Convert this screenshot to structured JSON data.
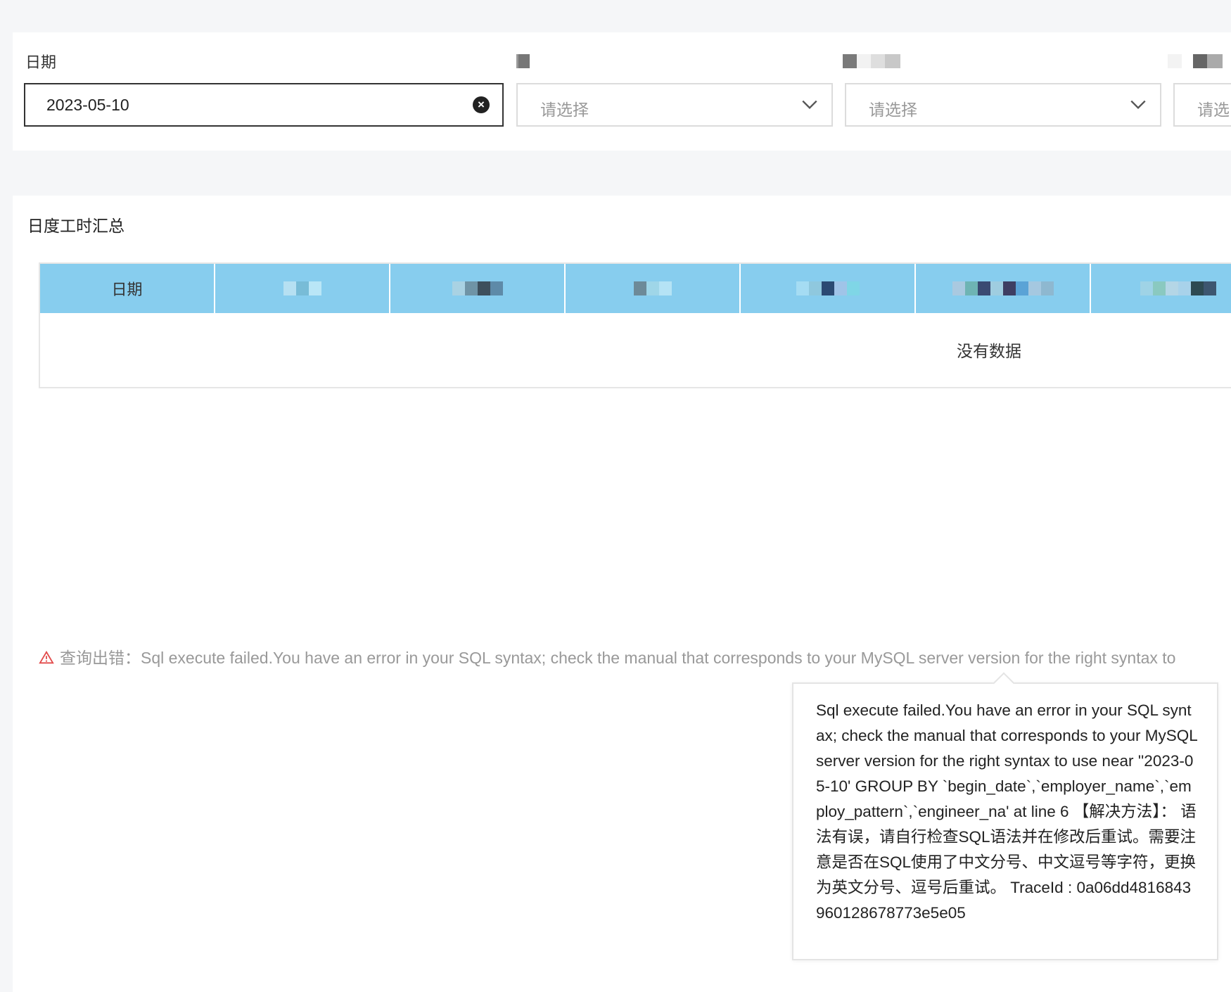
{
  "filters": {
    "date_label": "日期",
    "date_value": "2023-05-10",
    "select_placeholder": "请选择",
    "select_placeholder_cut": "请选"
  },
  "report": {
    "title": "日度工时汇总",
    "columns": [
      "日期"
    ],
    "empty_text": "没有数据"
  },
  "error": {
    "prefix": "查询出错：",
    "message": "Sql execute failed.You have an error in your SQL syntax; check the manual that corresponds to your MySQL server version for the right syntax to",
    "tooltip": "Sql execute failed.You have an error in your SQL syntax; check the manual that corresponds to your MySQL server version for the right syntax to use near ''2023-05-10' GROUP BY `begin_date`,`employer_name`,`employ_pattern`,`engineer_na' at line 6 【解决方法】： 语法有误，请自行检查SQL语法并在修改后重试。需要注意是否在SQL使用了中文分号、中文逗号等字符，更换为英文分号、逗号后重试。 TraceId : 0a06dd4816843960128678773e5e05"
  },
  "colors": {
    "header_bg": "#87cdee",
    "warn": "#e24b4b"
  }
}
